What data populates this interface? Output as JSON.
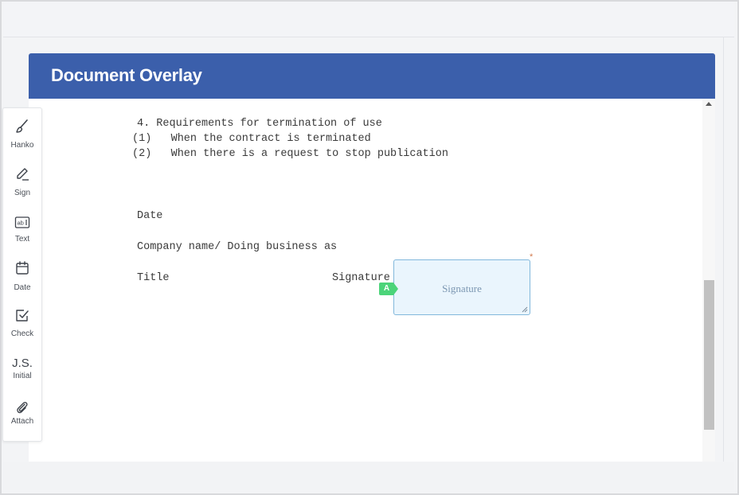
{
  "panel": {
    "title": "Document Overlay"
  },
  "document": {
    "lines": [
      "4. Requirements for termination of use",
      "(1)   When the contract is terminated",
      "(2)   When there is a request to stop publication",
      "Date",
      "Company name/ Doing business as",
      "Title",
      "Signature"
    ]
  },
  "signature_field": {
    "placeholder": "Signature",
    "assignee": "A",
    "required_mark": "*",
    "assignee_color": "#4cd47a",
    "border_color": "#82b8dc",
    "fill_color": "#eaf5fd"
  },
  "toolbar": {
    "tools": [
      {
        "label": "Hanko",
        "icon": "brush-icon"
      },
      {
        "label": "Sign",
        "icon": "pen-icon"
      },
      {
        "label": "Text",
        "icon": "text-field-icon"
      },
      {
        "label": "Date",
        "icon": "calendar-icon"
      },
      {
        "label": "Check",
        "icon": "checkbox-icon"
      },
      {
        "label": "Initial",
        "icon": "initials-icon",
        "glyph": "J.S."
      },
      {
        "label": "Attach",
        "icon": "paperclip-icon"
      }
    ]
  },
  "colors": {
    "header": "#3b5fab",
    "header_text": "#ffffff",
    "scroll_thumb": "#c1c1c1"
  }
}
